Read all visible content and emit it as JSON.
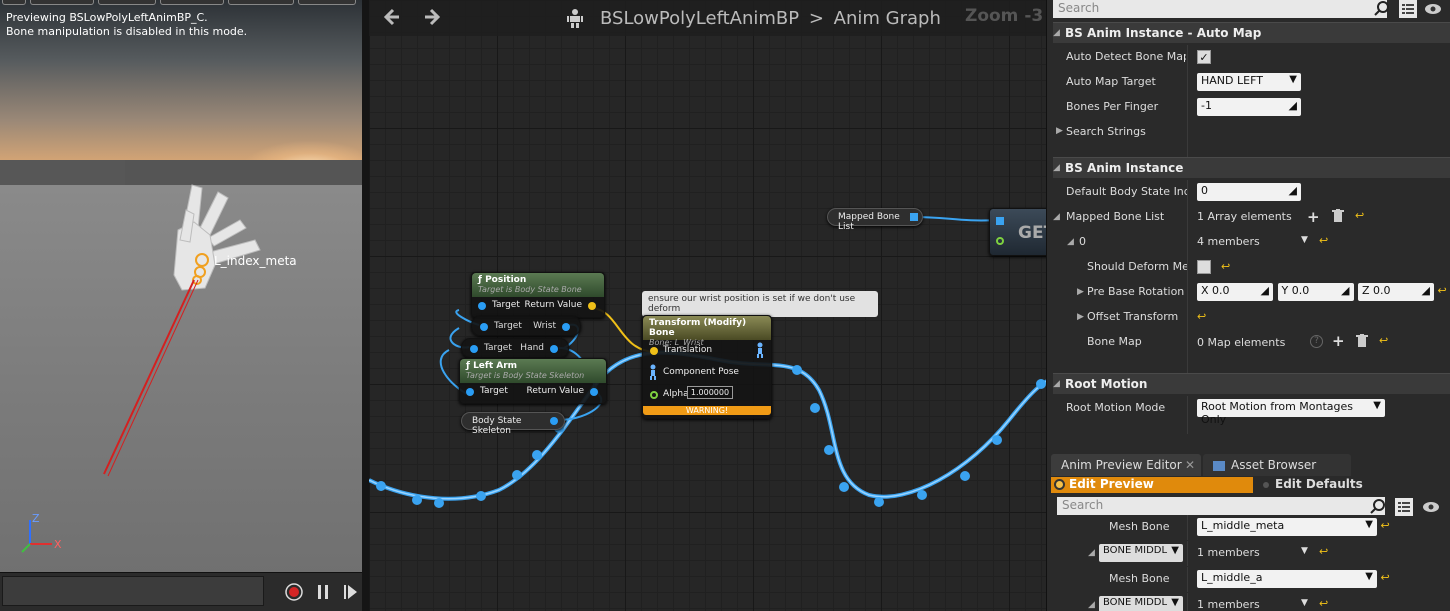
{
  "viewport": {
    "preview_line1": "Previewing BSLowPolyLeftAnimBP_C.",
    "preview_line2": "Bone manipulation is disabled in this mode.",
    "bone_label": "L_index_meta",
    "axis_z": "Z",
    "axis_x": "X"
  },
  "graph": {
    "title": "BSLowPolyLeftAnimBP",
    "breadcrumb_sep": ">",
    "subtitle": "Anim Graph",
    "zoom": "Zoom -3",
    "position_node": {
      "title": "Position",
      "sub": "Target is Body State Bone",
      "pin_target": "Target",
      "pin_return": "Return Value"
    },
    "wrist_node": {
      "pin_target": "Target",
      "pin_out": "Wrist"
    },
    "hand_node": {
      "pin_target": "Target",
      "pin_out": "Hand"
    },
    "leftarm_node": {
      "title": "Left Arm",
      "sub": "Target is Body State Skeleton",
      "pin_target": "Target",
      "pin_return": "Return Value"
    },
    "skeleton_var": "Body State Skeleton",
    "comment": "ensure our wrist position is set if we don't use deform",
    "transform_node": {
      "title": "Transform (Modify) Bone",
      "sub": "Bone: L_Wrist",
      "translation": "Translation",
      "component_pose": "Component Pose",
      "alpha_label": "Alpha",
      "alpha_value": "1.000000",
      "warning": "WARNING!"
    },
    "mapped_var": "Mapped Bone List",
    "get_node": "GET"
  },
  "details": {
    "search_placeholder": "Search",
    "auto_map": {
      "header": "BS Anim Instance - Auto Map",
      "auto_detect_label": "Auto Detect Bone Map at",
      "auto_map_target_label": "Auto Map Target",
      "auto_map_target_value": "HAND LEFT",
      "bones_per_finger_label": "Bones Per Finger",
      "bones_per_finger_value": "-1",
      "search_strings_label": "Search Strings"
    },
    "anim_instance": {
      "header": "BS Anim Instance",
      "default_index_label": "Default Body State Index",
      "default_index_value": "0",
      "mapped_list_label": "Mapped Bone List",
      "mapped_list_value": "1 Array elements",
      "element_label": "0",
      "element_value": "4 members",
      "should_deform_label": "Should Deform Mesh",
      "pre_base_rotation_label": "Pre Base Rotation",
      "rot_x_label": "X",
      "rot_x": "0.0",
      "rot_y_label": "Y",
      "rot_y": "0.0",
      "rot_z_label": "Z",
      "rot_z": "0.0",
      "offset_transform_label": "Offset Transform",
      "bone_map_label": "Bone Map",
      "bone_map_value": "0 Map elements"
    },
    "root_motion": {
      "header": "Root Motion",
      "mode_label": "Root Motion Mode",
      "mode_value": "Root Motion from Montages Only"
    }
  },
  "preview": {
    "tab_anim_preview": "Anim Preview Editor",
    "tab_asset_browser": "Asset Browser",
    "edit_preview": "Edit Preview",
    "edit_defaults": "Edit Defaults",
    "search_placeholder": "Search",
    "mesh_bone_label_1": "Mesh Bone",
    "mesh_bone_value_1": "L_middle_meta",
    "bone_combo_1": "BONE MIDDL",
    "members_1": "1 members",
    "mesh_bone_label_2": "Mesh Bone",
    "mesh_bone_value_2": "L_middle_a",
    "bone_combo_2": "BONE MIDDL",
    "members_2": "1 members"
  },
  "colors": {
    "accent_orange": "#e08a0c",
    "exec_wire_blue": "#3aa3f0",
    "warning": "#f09b16"
  }
}
